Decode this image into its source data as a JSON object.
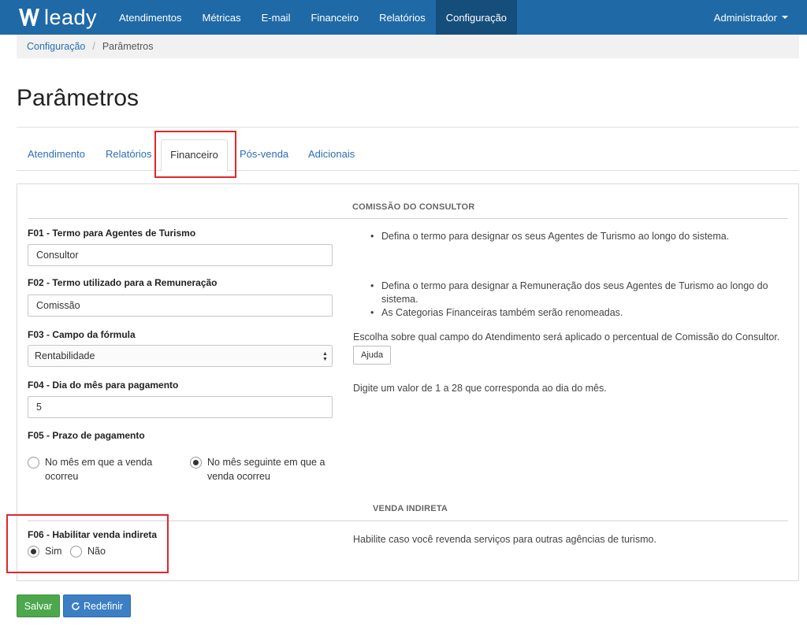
{
  "brand": {
    "name": "leady"
  },
  "nav": {
    "items": [
      {
        "label": "Atendimentos"
      },
      {
        "label": "Métricas"
      },
      {
        "label": "E-mail"
      },
      {
        "label": "Financeiro"
      },
      {
        "label": "Relatórios"
      },
      {
        "label": "Configuração"
      }
    ],
    "active_index": 5,
    "user_menu": "Administrador"
  },
  "breadcrumb": {
    "parent": "Configuração",
    "current": "Parâmetros"
  },
  "page": {
    "title": "Parâmetros"
  },
  "tabs": [
    {
      "label": "Atendimento"
    },
    {
      "label": "Relatórios"
    },
    {
      "label": "Financeiro"
    },
    {
      "label": "Pós-venda"
    },
    {
      "label": "Adicionais"
    }
  ],
  "sections": {
    "commission": "COMISSÃO DO CONSULTOR",
    "indirect": "VENDA INDIRETA"
  },
  "fields": {
    "f01": {
      "label": "F01 - Termo para Agentes de Turismo",
      "value": "Consultor",
      "help": [
        "Defina o termo para designar os seus Agentes de Turismo ao longo do sistema."
      ]
    },
    "f02": {
      "label": "F02 - Termo utilizado para a Remuneração",
      "value": "Comissão",
      "help_1": "Defina o termo para designar a Remuneração dos seus Agentes de Turismo ao longo do",
      "help_1b": "sistema.",
      "help_2": "As Categorias Financeiras também serão renomeadas."
    },
    "f03": {
      "label": "F03 - Campo da fórmula",
      "value": "Rentabilidade",
      "help": "Escolha sobre qual campo do Atendimento será aplicado o percentual de Comissão do Consultor.",
      "help_button": "Ajuda"
    },
    "f04": {
      "label": "F04 - Dia do mês para pagamento",
      "value": "5",
      "help": "Digite um valor de 1 a 28 que corresponda ao dia do mês."
    },
    "f05": {
      "label": "F05 - Prazo de pagamento",
      "option_1_line1": "No mês em que a venda",
      "option_1_line2": "ocorreu",
      "option_2_line1": "No mês seguinte em que a",
      "option_2_line2": "venda ocorreu",
      "selected": 2
    },
    "f06": {
      "label": "F06 - Habilitar venda indireta",
      "option_yes": "Sim",
      "option_no": "Não",
      "selected": "yes",
      "help": "Habilite caso você revenda serviços para outras agências de turismo."
    }
  },
  "actions": {
    "save": "Salvar",
    "reset": "Redefinir"
  },
  "colors": {
    "navbar": "#1f69a6",
    "navbar_active": "#154d7b",
    "highlight": "#e0262d",
    "save": "#4da84d",
    "reset": "#3d7fc4"
  }
}
